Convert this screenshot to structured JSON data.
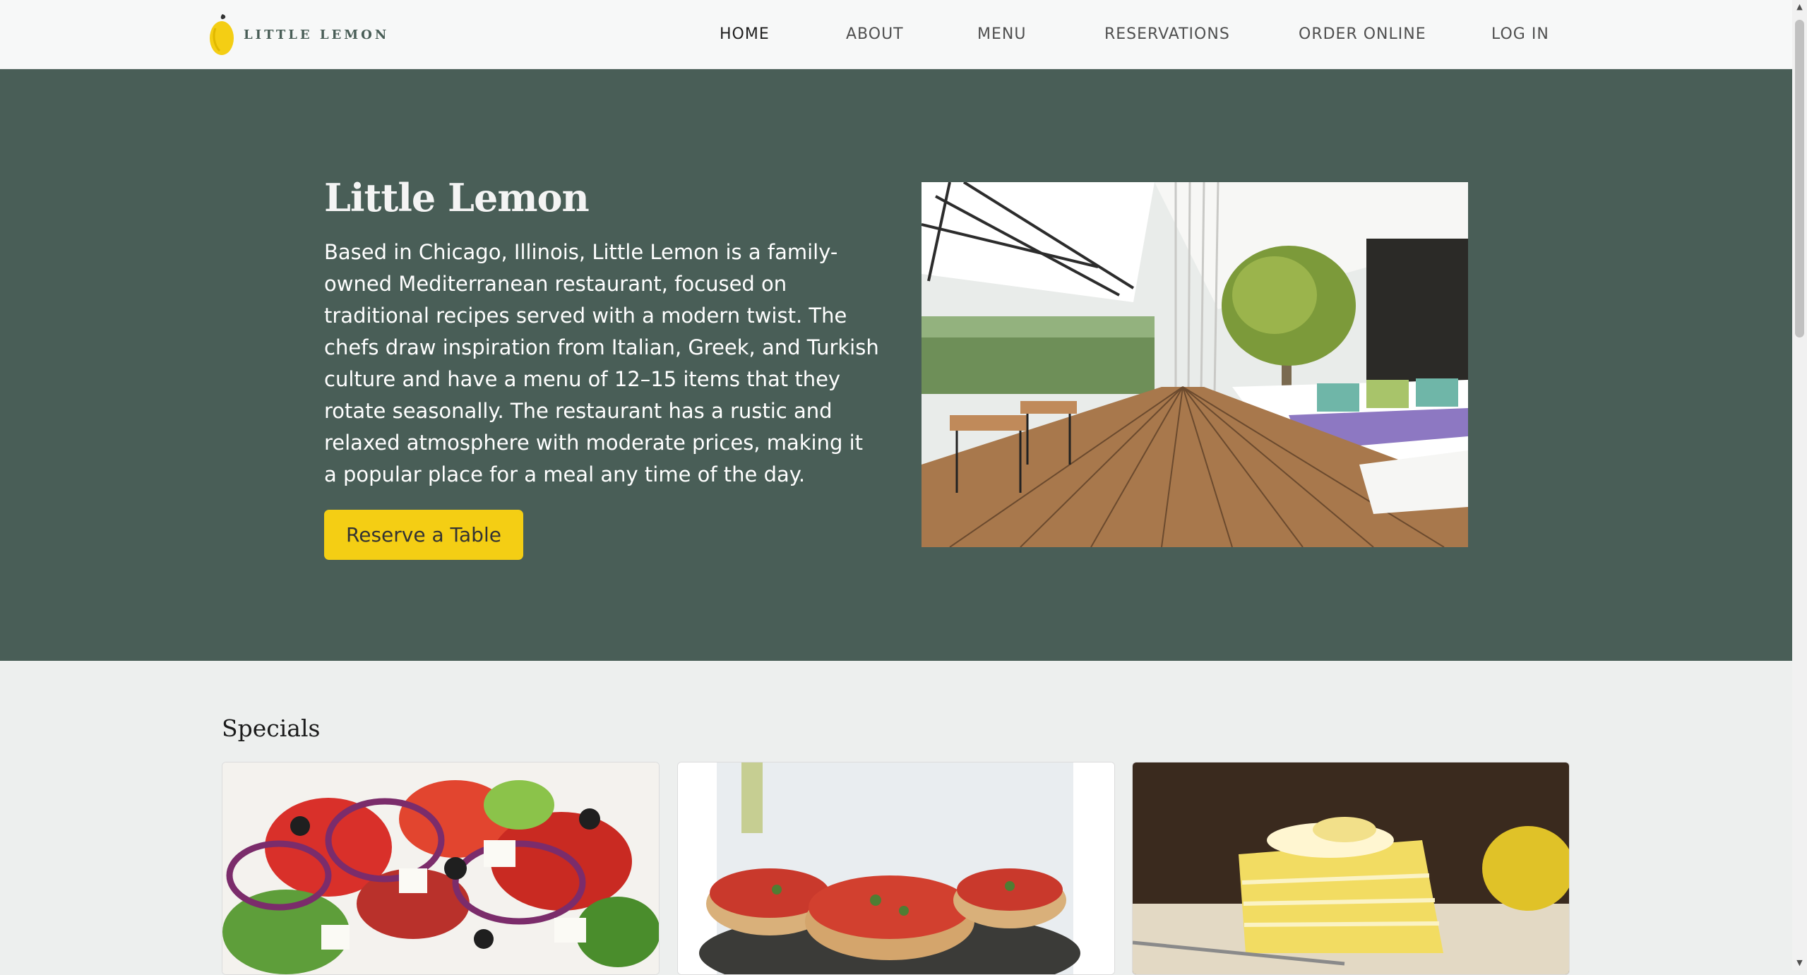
{
  "brand": {
    "logo_text": "LITTLE LEMON",
    "accent": "#f4ce14",
    "primary": "#495e57"
  },
  "nav": {
    "items": [
      {
        "label": "HOME",
        "active": true
      },
      {
        "label": "ABOUT"
      },
      {
        "label": "MENU"
      },
      {
        "label": "RESERVATIONS"
      },
      {
        "label": "ORDER ONLINE"
      },
      {
        "label": "LOG IN"
      }
    ]
  },
  "hero": {
    "title": "Little Lemon",
    "description": "Based in Chicago, Illinois, Little Lemon is a family-owned Mediterranean restaurant, focused on traditional recipes served with a modern twist. The chefs draw inspiration from Italian, Greek, and Turkish culture and have a menu of 12–15 items that they rotate seasonally. The restaurant has a rustic and relaxed atmosphere with moderate prices, making it a popular place for a meal any time of the day.",
    "button_label": "Reserve a Table",
    "image": "restaurant-terrace-photo"
  },
  "specials": {
    "title": "Specials",
    "cards": [
      {
        "image": "greek-salad-photo"
      },
      {
        "image": "bruschetta-photo"
      },
      {
        "image": "lemon-dessert-photo"
      }
    ]
  },
  "scrollbar": {
    "up_icon": "▲",
    "down_icon": "▼"
  }
}
